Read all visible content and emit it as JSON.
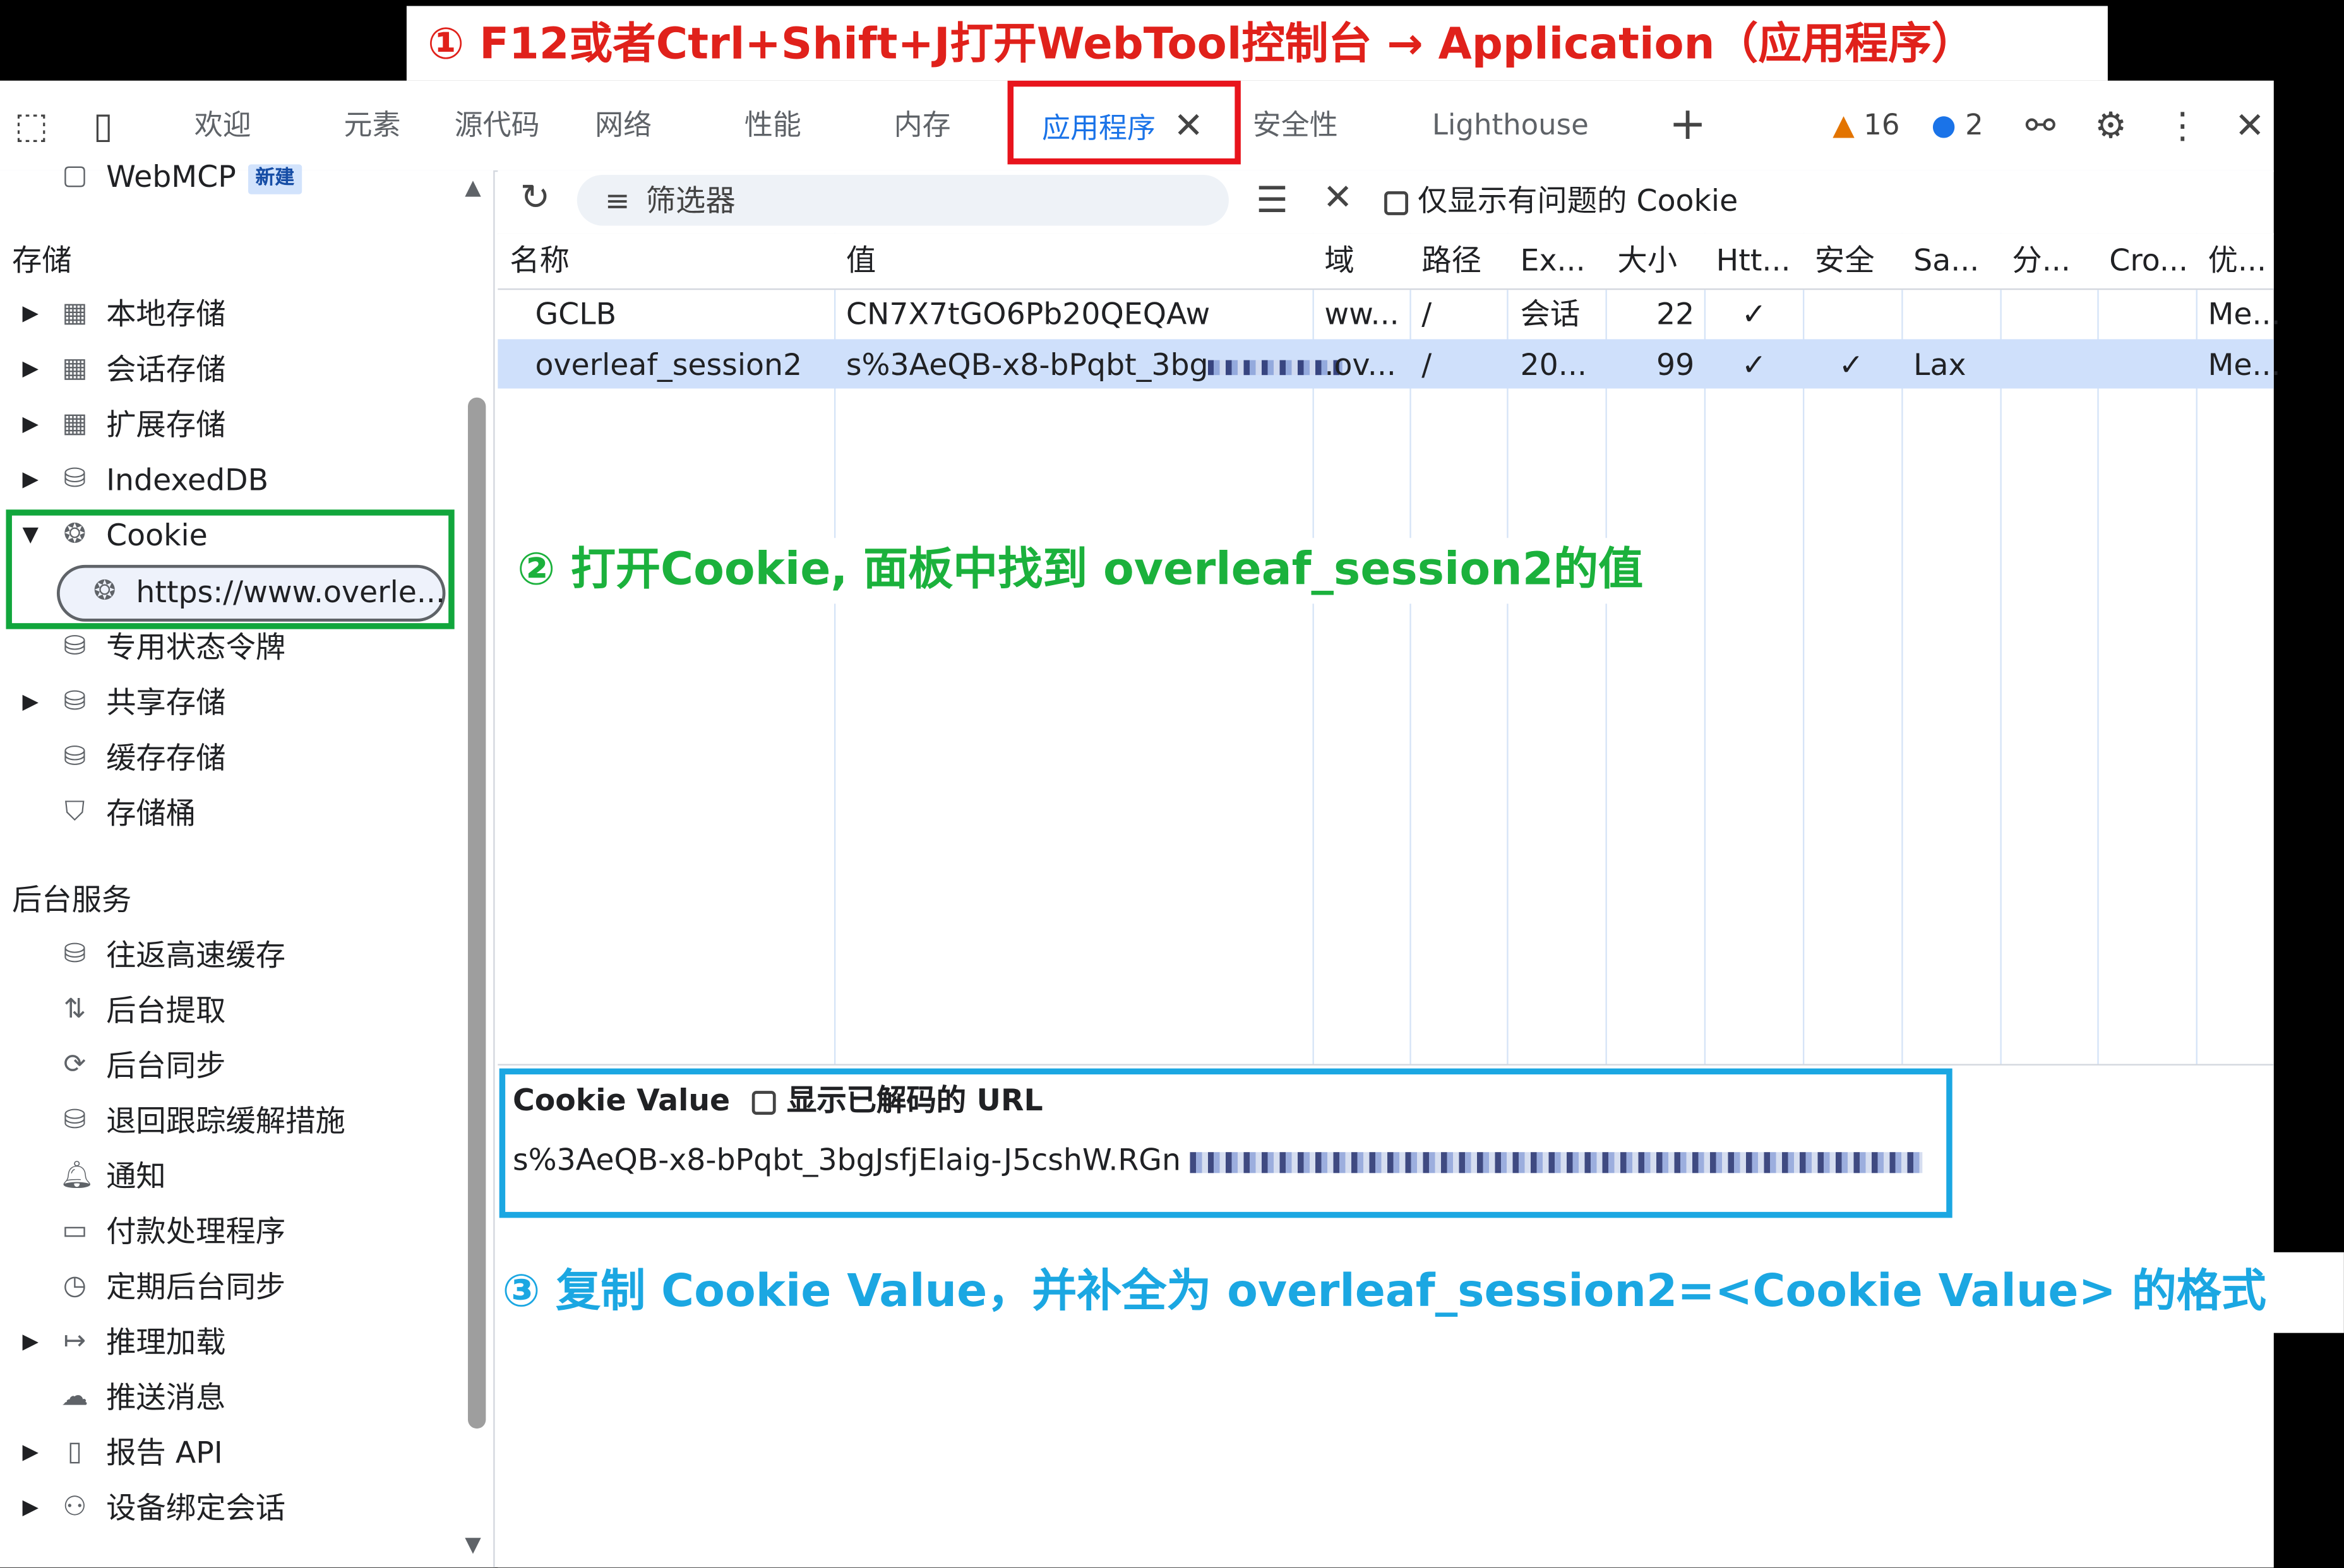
{
  "banner": {
    "text": "① F12或者Ctrl+Shift+J打开WebTool控制台 → Application（应用程序）"
  },
  "tabs": [
    {
      "label": "欢迎"
    },
    {
      "label": "元素"
    },
    {
      "label": "源代码"
    },
    {
      "label": "网络"
    },
    {
      "label": "性能"
    },
    {
      "label": "内存"
    },
    {
      "label": "应用程序"
    },
    {
      "label": "安全性"
    },
    {
      "label": "Lighthouse"
    }
  ],
  "status": {
    "warnings": "16",
    "messages": "2"
  },
  "sidebar": {
    "webmcp": "WebMCP",
    "new_badge": "新建",
    "storage_header": "存储",
    "storage_items": [
      {
        "label": "本地存储",
        "icon": "grid-icon"
      },
      {
        "label": "会话存储",
        "icon": "grid-icon"
      },
      {
        "label": "扩展存储",
        "icon": "grid-icon"
      },
      {
        "label": "IndexedDB",
        "icon": "database-icon"
      },
      {
        "label": "Cookie",
        "icon": "cookie-icon"
      },
      {
        "label": "https://www.overle...",
        "icon": "cookie-icon"
      },
      {
        "label": "专用状态令牌",
        "icon": "database-icon"
      },
      {
        "label": "共享存储",
        "icon": "database-icon"
      },
      {
        "label": "缓存存储",
        "icon": "database-icon"
      },
      {
        "label": "存储桶",
        "icon": "bucket-icon"
      }
    ],
    "services_header": "后台服务",
    "service_items": [
      {
        "label": "往返高速缓存"
      },
      {
        "label": "后台提取"
      },
      {
        "label": "后台同步"
      },
      {
        "label": "退回跟踪缓解措施"
      },
      {
        "label": "通知"
      },
      {
        "label": "付款处理程序"
      },
      {
        "label": "定期后台同步"
      },
      {
        "label": "推理加载"
      },
      {
        "label": "推送消息"
      },
      {
        "label": "报告 API"
      },
      {
        "label": "设备绑定会话"
      }
    ]
  },
  "toolbar": {
    "filter_placeholder": "筛选器",
    "only_issues_label": "仅显示有问题的 Cookie"
  },
  "table": {
    "headers": [
      "名称",
      "值",
      "域",
      "路径",
      "Ex...",
      "大小",
      "Htt...",
      "安全",
      "Sa...",
      "分...",
      "Cro...",
      "优..."
    ],
    "rows": [
      [
        "GCLB",
        "CN7X7tGO6Pb20QEQAw",
        "ww...",
        "/",
        "会话",
        "22",
        "✓",
        "",
        "",
        "",
        "",
        "Me..."
      ],
      [
        "overleaf_session2",
        "s%3AeQB-x8-bPqbt_3bg",
        ".ov...",
        "/",
        "20...",
        "99",
        "✓",
        "✓",
        "Lax",
        "",
        "",
        "Me..."
      ]
    ]
  },
  "cookie_value": {
    "title": "Cookie Value",
    "show_decoded_label": "显示已解码的 URL",
    "value": "s%3AeQB-x8-bPqbt_3bgJsfjElaig-J5cshW.RGn"
  },
  "annotations": {
    "step2": "② 打开Cookie, 面板中找到 overleaf_session2的值",
    "step3": "③ 复制 Cookie Value，并补全为 overleaf_session2=<Cookie Value> 的格式"
  },
  "colors": {
    "step1": "#e0211b",
    "step2": "#1bb13c",
    "step3": "#1ba7e2",
    "accent": "#1a73e8"
  }
}
